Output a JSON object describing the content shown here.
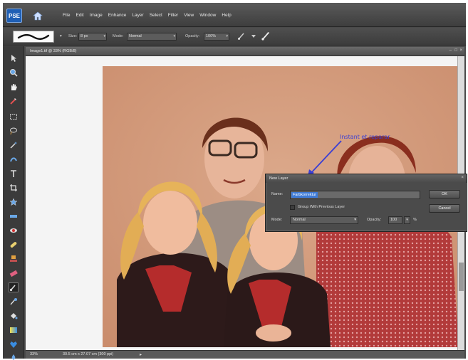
{
  "app": {
    "logo_text": "PSE",
    "menus": [
      "File",
      "Edit",
      "Image",
      "Enhance",
      "Layer",
      "Select",
      "Filter",
      "View",
      "Window",
      "Help"
    ]
  },
  "options_bar": {
    "size_label": "Size:",
    "size_value": "8 px",
    "mode_label": "Mode:",
    "mode_value": "Normal",
    "opacity_label": "Opacity:",
    "opacity_value": "100%"
  },
  "document": {
    "title": "Image1.tif @ 33% (RGB/8)",
    "zoom": "33%",
    "info": "30.5 cm x 27.07 cm (300 ppi)"
  },
  "dialog": {
    "title": "New Layer",
    "name_label": "Name:",
    "name_value": "Farbkorrektur",
    "group_label": "Group With Previous Layer",
    "mode_label": "Mode:",
    "mode_value": "Normal",
    "opacity_label": "Opacity:",
    "opacity_value": "100",
    "percent": "%",
    "ok_label": "OK",
    "cancel_label": "Cancel"
  },
  "annotation": {
    "text": "Instant et reparar"
  },
  "colors": {
    "ui_dark": "#4a4a4a",
    "photo_tone": "#d9a27c",
    "selection": "#3f7bd6",
    "annotation": "#3b3fd4",
    "sweater_red": "#b52c2c"
  },
  "icons": {
    "home": "home-icon",
    "brush": "brush-icon",
    "airbrush": "airbrush-icon"
  }
}
